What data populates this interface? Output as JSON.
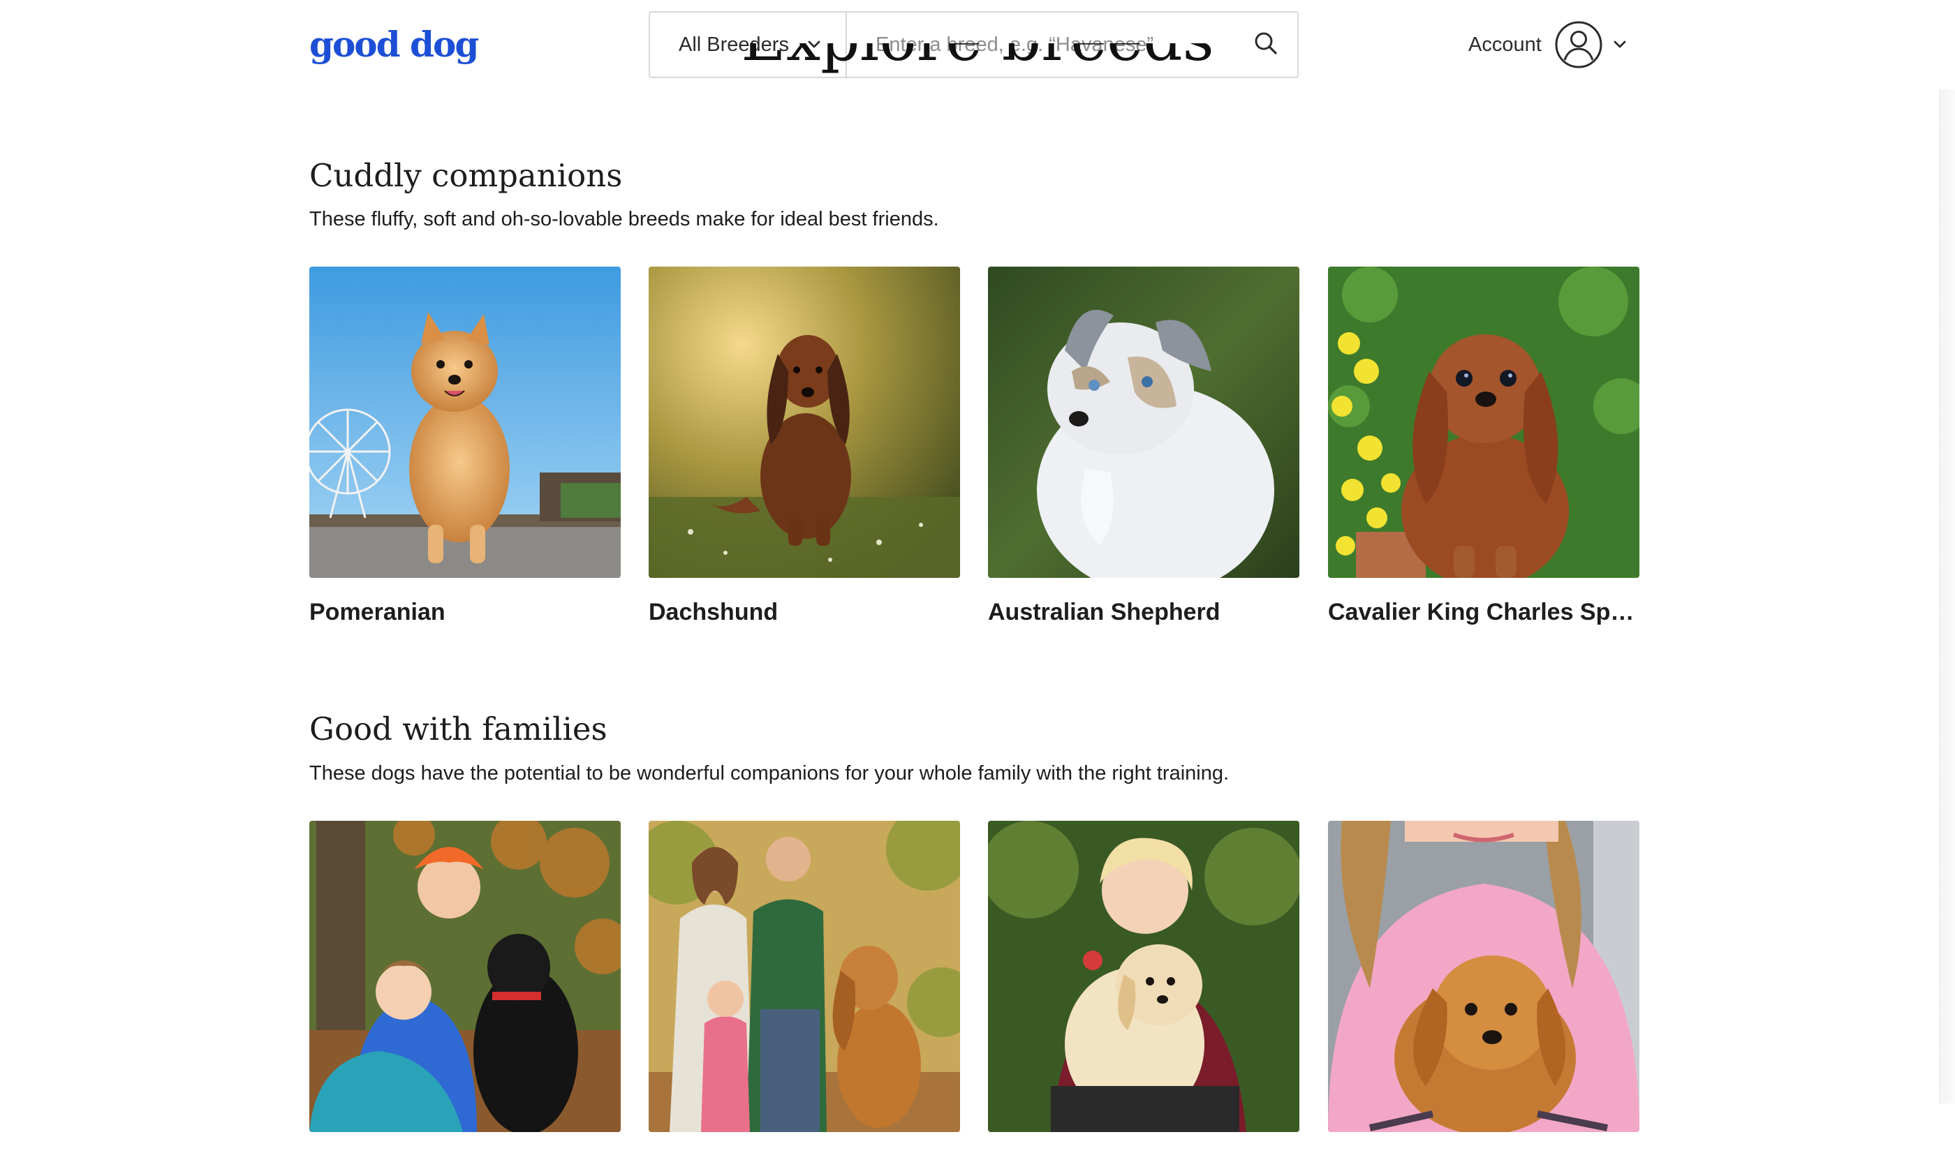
{
  "header": {
    "logo": "good dog",
    "breeders_filter": "All Breeders",
    "search_placeholder": "Enter a breed, e.g. “Havanese”",
    "account_label": "Account"
  },
  "page_heading_partial": "Explore breeds",
  "sections": [
    {
      "title": "Cuddly companions",
      "description": "These fluffy, soft and oh-so-lovable breeds make for ideal best friends.",
      "cards": [
        {
          "name": "Pomeranian"
        },
        {
          "name": "Dachshund"
        },
        {
          "name": "Australian Shepherd"
        },
        {
          "name": "Cavalier King Charles Spa..."
        }
      ]
    },
    {
      "title": "Good with families",
      "description": "These dogs have the potential to be wonderful companions for your whole family with the right training.",
      "cards": [
        {
          "name": ""
        },
        {
          "name": ""
        },
        {
          "name": ""
        },
        {
          "name": ""
        }
      ]
    }
  ],
  "colors": {
    "brand": "#1d4fd6",
    "border": "#d8d8d8",
    "text": "#1d1d1f",
    "placeholder": "#8d8d8d"
  },
  "icons": {
    "filter_chevron": "chevron-down-icon",
    "search": "search-icon",
    "account_avatar": "user-circle-icon",
    "account_chevron": "chevron-down-icon"
  }
}
